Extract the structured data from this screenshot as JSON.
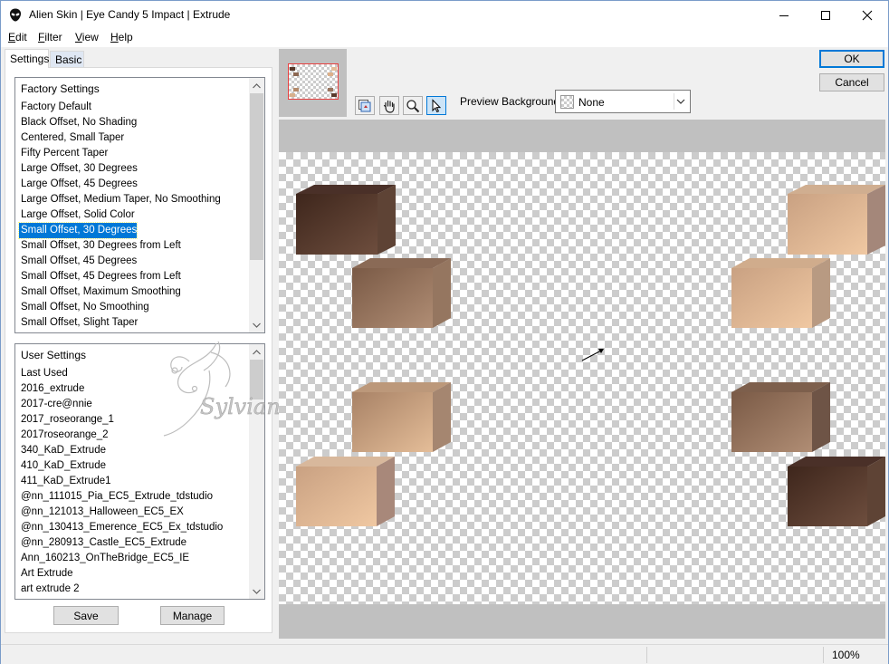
{
  "window": {
    "title": "Alien Skin | Eye Candy 5 Impact | Extrude",
    "minimize_icon": "minimize-icon",
    "maximize_icon": "maximize-icon",
    "close_icon": "close-icon"
  },
  "menu": [
    {
      "mnemonic": "E",
      "rest": "dit"
    },
    {
      "mnemonic": "F",
      "rest": "ilter"
    },
    {
      "mnemonic": "V",
      "rest": "iew"
    },
    {
      "mnemonic": "H",
      "rest": "elp"
    }
  ],
  "tabs": {
    "settings": "Settings",
    "basic": "Basic"
  },
  "factory_settings": {
    "header": "Factory Settings",
    "items": [
      "Factory Default",
      "Black Offset, No Shading",
      "Centered, Small Taper",
      "Fifty Percent Taper",
      "Large Offset, 30 Degrees",
      "Large Offset, 45 Degrees",
      "Large Offset, Medium Taper, No Smoothing",
      "Large Offset, Solid Color",
      "Small Offset, 30 Degrees",
      "Small Offset, 30 Degrees from Left",
      "Small Offset, 45 Degrees",
      "Small Offset, 45 Degrees from Left",
      "Small Offset, Maximum Smoothing",
      "Small Offset, No Smoothing",
      "Small Offset, Slight Taper"
    ],
    "selected": "Small Offset, 30 Degrees"
  },
  "user_settings": {
    "header": "User Settings",
    "items": [
      "Last Used",
      "2016_extrude",
      "2017-cre@nnie",
      "2017_roseorange_1",
      "2017roseorange_2",
      "340_KaD_Extrude",
      "410_KaD_Extrude",
      "411_KaD_Extrude1",
      "@nn_111015_Pia_EC5_Extrude_tdstudio",
      "@nn_121013_Halloween_EC5_EX",
      "@nn_130413_Emerence_EC5_Ex_tdstudio",
      "@nn_280913_Castle_EC5_Extrude",
      "Ann_160213_OnTheBridge_EC5_IE",
      "Art Extrude",
      "art extrude 2"
    ]
  },
  "watermark_text": "Sylviane",
  "buttons": {
    "save": "Save",
    "manage": "Manage",
    "ok": "OK",
    "cancel": "Cancel"
  },
  "tools": [
    "navigator-icon",
    "hand-pan-icon",
    "zoom-icon",
    "pointer-arrow-icon"
  ],
  "preview_background": {
    "label": "Preview Background:",
    "value": "None"
  },
  "status": {
    "zoom": "100%"
  },
  "colors": {
    "accent": "#0078d7",
    "dark_brown": "#4a2f24",
    "mid_brown": "#8b6750",
    "tan": "#c8a07e",
    "peach": "#e8c09c"
  }
}
